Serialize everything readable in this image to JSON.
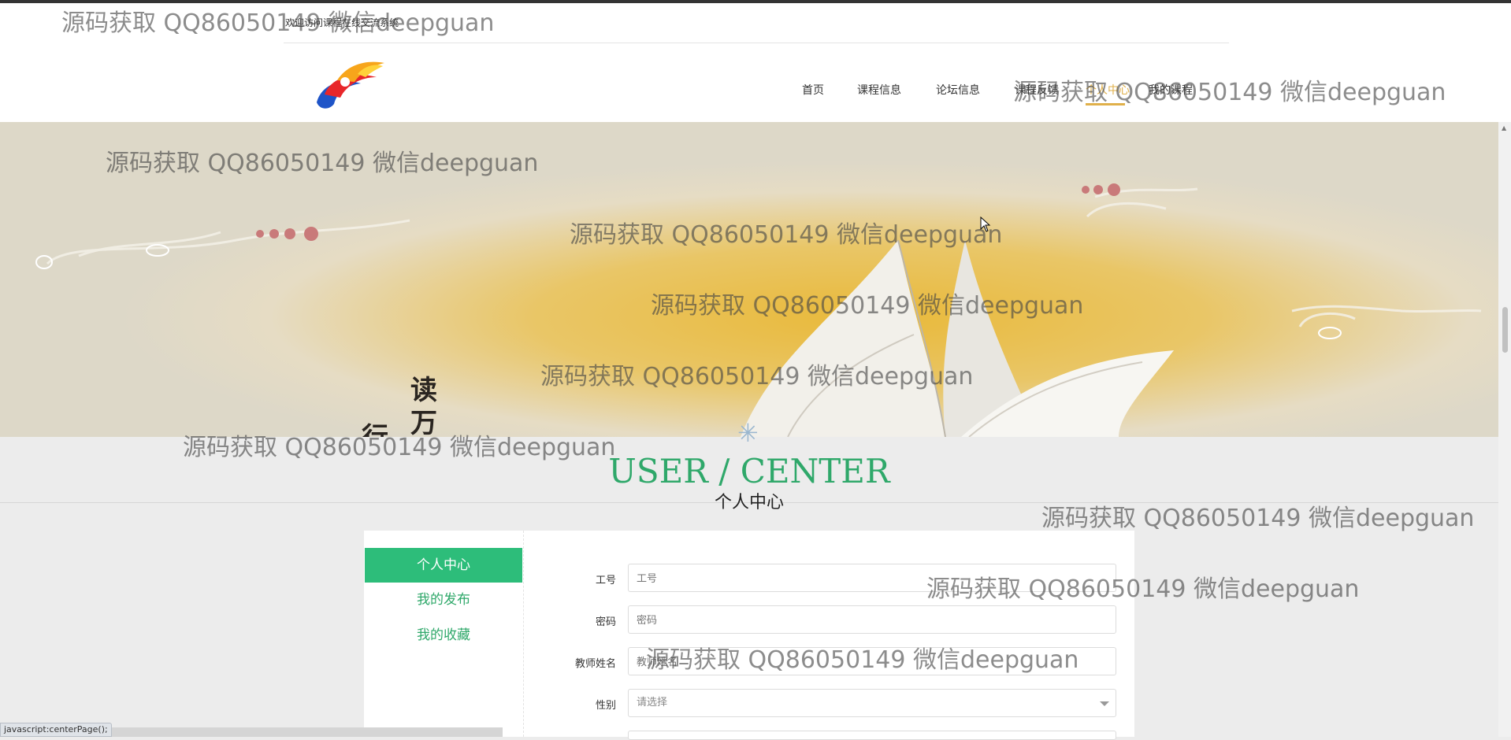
{
  "header": {
    "welcome_text": "欢迎访问课程在线交流系统",
    "logo_icon": "flame-logo-icon",
    "nav": [
      {
        "label": "首页"
      },
      {
        "label": "课程信息"
      },
      {
        "label": "论坛信息"
      },
      {
        "label": "课程反馈"
      },
      {
        "label": "个人中心"
      },
      {
        "label": "我的课程"
      }
    ],
    "accent_color": "#e0b04a"
  },
  "banner": {
    "slogan_line1": "读万卷书",
    "slogan_line2": "行万里路"
  },
  "section": {
    "title": "USER / CENTER",
    "subtitle": "个人中心",
    "title_color": "#2fa86a"
  },
  "sidebar": {
    "items": [
      {
        "label": "个人中心",
        "active": true
      },
      {
        "label": "我的发布",
        "active": false
      },
      {
        "label": "我的收藏",
        "active": false
      }
    ],
    "active_color": "#2dbd7a"
  },
  "form": {
    "fields": [
      {
        "label": "工号",
        "placeholder": "工号"
      },
      {
        "label": "密码",
        "placeholder": "密码"
      },
      {
        "label": "教师姓名",
        "placeholder": "教师姓名"
      },
      {
        "label": "性别",
        "placeholder": "请选择"
      }
    ]
  },
  "status_bar": {
    "text": "javascript:centerPage();"
  },
  "watermark": "源码获取 QQ86050149 微信deepguan"
}
